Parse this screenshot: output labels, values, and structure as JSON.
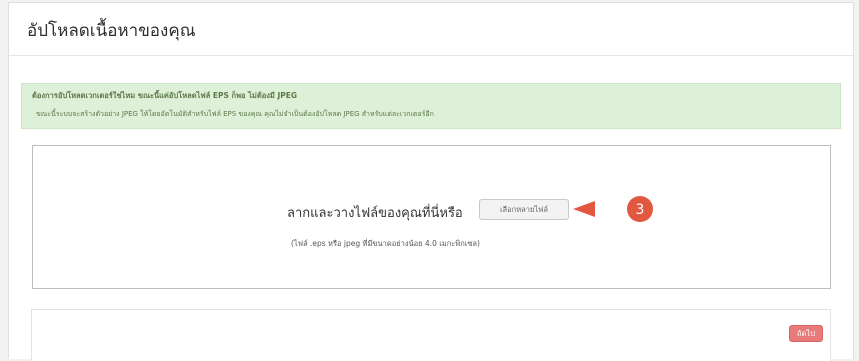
{
  "page": {
    "title": "อัปโหลดเนื้อหาของคุณ"
  },
  "notice": {
    "title": "ต้องการอัปโหลดเวกเตอร์ใช่ไหม ขณะนี้แค่อัปโหลดไฟล์ EPS ก็พอ ไม่ต้องมี JPEG",
    "body": "ขณะนี้ระบบจะสร้างตัวอย่าง JPEG ให้โดยอัตโนมัติสำหรับไฟล์ EPS ของคุณ คุณไม่จำเป็นต้องอัปโหลด JPEG สำหรับแต่ละเวกเตอร์อีก"
  },
  "dropzone": {
    "prompt": "ลากและวางไฟล์ของคุณที่นี่หรือ",
    "choose_button": "เลือกหลายไฟล์",
    "hint": "(ไฟล์ .eps หรือ jpeg ที่มีขนาดอย่างน้อย 4.0 เมกะพิกเซล)",
    "callout_number": "3"
  },
  "footer": {
    "next_button": "ถัดไป"
  },
  "colors": {
    "notice_bg": "#dff0d8",
    "notice_text": "#5c7a4a",
    "callout": "#e2573f",
    "next_button": "#e97a7a"
  }
}
